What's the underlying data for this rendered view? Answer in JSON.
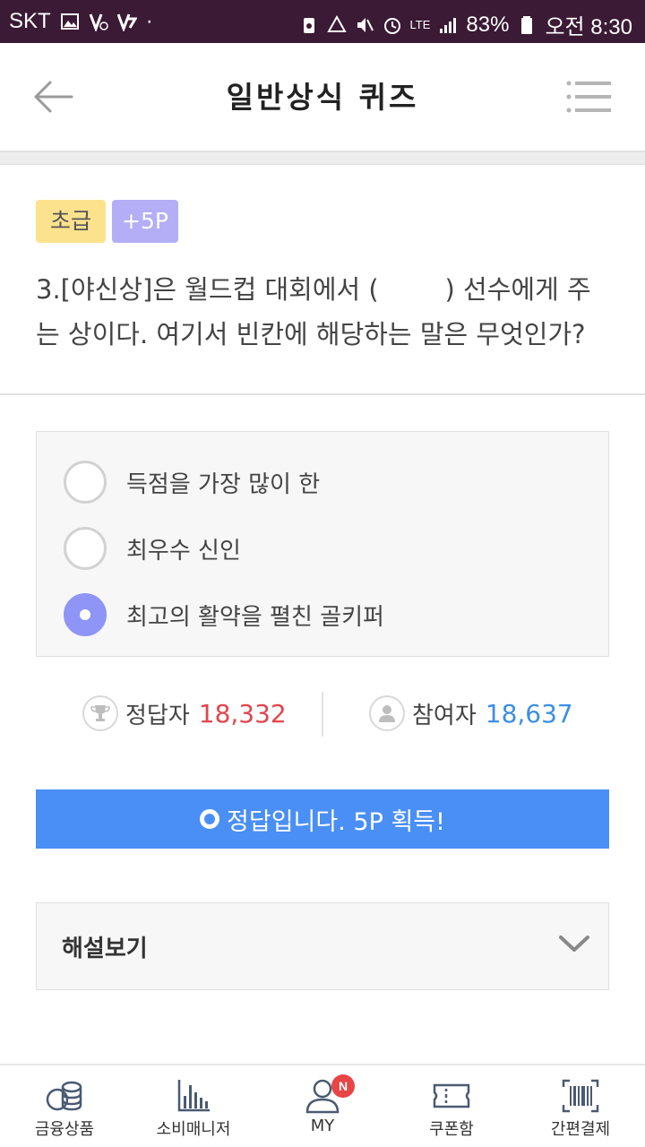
{
  "status_bar": {
    "carrier": "SKT",
    "battery": "83%",
    "network": "LTE",
    "time": "오전 8:30",
    "colors": {
      "background": "#3b1a35",
      "text": "#ffffff"
    }
  },
  "header": {
    "title": "일반상식 퀴즈",
    "back_icon": "arrow-left-icon",
    "menu_icon": "menu-list-icon"
  },
  "quiz": {
    "level_tag": "초급",
    "point_tag": "+5P",
    "question": "3.[야신상]은 월드컵 대회에서 (        ) 선수에게 주는 상이다. 여기서 빈칸에 해당하는 말은 무엇인가?",
    "options": [
      {
        "label": "득점을 가장 많이 한",
        "selected": false
      },
      {
        "label": "최우수 신인",
        "selected": false
      },
      {
        "label": "최고의 활약을 펼친 골키퍼",
        "selected": true
      }
    ],
    "stats": {
      "correct_label": "정답자",
      "correct_value": "18,332",
      "participants_label": "참여자",
      "participants_value": "18,637"
    },
    "result_banner": "정답입니다. 5P 획득!",
    "explanation_label": "해설보기"
  },
  "bottom_nav": {
    "items": [
      {
        "label": "금융상품",
        "icon": "coins-icon"
      },
      {
        "label": "소비매니저",
        "icon": "bar-chart-icon"
      },
      {
        "label": "MY",
        "icon": "person-icon",
        "badge": "N"
      },
      {
        "label": "쿠폰함",
        "icon": "ticket-icon"
      },
      {
        "label": "간편결제",
        "icon": "barcode-icon"
      }
    ]
  },
  "colors": {
    "accent_blue": "#4a8ff5",
    "radio_selected": "#8f95f7",
    "level_tag": "#fde28e",
    "point_tag": "#b4aef7",
    "correct_count": "#e2454d",
    "participant_count": "#3d8ee6"
  }
}
